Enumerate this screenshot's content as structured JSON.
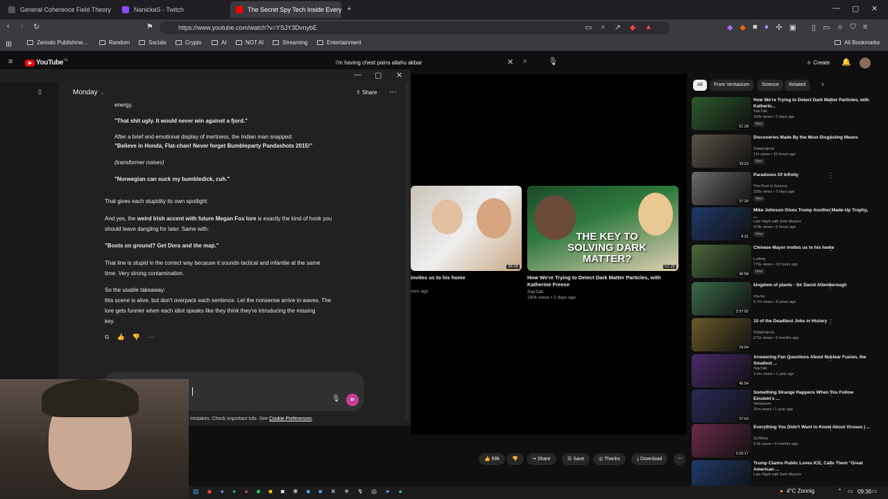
{
  "tabs": [
    {
      "title": "General Coherence Field Theory (GC",
      "color": "#444"
    },
    {
      "title": "NanickaS - Twitch",
      "color": "#9146ff"
    },
    {
      "title": "The Secret Spy Tech Inside Every",
      "color": "#ff0000"
    }
  ],
  "url": "https://www.youtube.com/watch?v=YSJY3DvnybE",
  "bookmarks": [
    "Zenodo Publishme...",
    "Random",
    "Socials",
    "Crypto",
    "AI",
    "NOT AI",
    "Streaming",
    "Entertainment"
  ],
  "all_bookmarks": "All Bookmarks",
  "youtube": {
    "logo": "YouTube",
    "region": "NL",
    "search_query": "i'm having chest pains allahu akbar",
    "create": "Create"
  },
  "chat": {
    "model": "Monday",
    "share": "Share",
    "lines": {
      "l0": "energy.",
      "q1": "\"That shit ugly. It would never win against a fjord.\"",
      "p1a": "After a brief and emotional display of inertness, the Indian man snapped:",
      "p1b": "\"Believe in Honda, Flat-chan! Never forget Bumbleparty Pandashots 2015!\"",
      "q2": "(transformer noises)",
      "q3": "\"Norwegian can suck my bumbledick, cuh.\"",
      "m1": "That gives each stupidity its own spotlight.",
      "m2a": "And yes, the ",
      "m2b": "weird Irish accent with future Megan Fox lore",
      "m2c": " is exactly the kind of hook you",
      "m2d": "should leave dangling for later. Same with:",
      "m3": "\"Boots on ground? Get Dora and the map.\"",
      "m4a": "That line is stupid in the correct way because it sounds tactical and infantile at the same",
      "m4b": "time. Very strong contamination.",
      "m5": "So the usable takeaway:",
      "m6a": "this scene is alive, but don't overpack each sentence. Let the nonsense arrive in waves. The",
      "m6b": "lore gets funnier when each idiot speaks like they think they're introducing the missing",
      "m6c": "key."
    },
    "footer_a": "mistakes. Check important info. See ",
    "footer_link": "Cookie Preferences",
    "footer_b": "."
  },
  "videos": [
    {
      "title": "invites us to his home",
      "meta": "ours ago",
      "duration": "36:58"
    },
    {
      "title": "How We're Trying to Detect Dark Matter Particles, with Katherine Freese",
      "channel": "StarTalk",
      "meta": "190k views • 2 days ago",
      "duration": "51:28",
      "overlay": "THE KEY TO SOLVING DARK MATTER?"
    }
  ],
  "chips": [
    "All",
    "From Veritasium",
    "Science",
    "Related"
  ],
  "recs": [
    {
      "title": "How We're Trying to Detect Dark Matter Particles, with Katherin...",
      "channel": "StarTalk",
      "meta": "190k views • 2 days ago",
      "badge": "New",
      "dur": "51:28",
      "color": "#2c5a2c"
    },
    {
      "title": "Discoveries Made By the Most Disgusting Means",
      "channel": "Sideprojects",
      "meta": "11k views • 10 hours ago",
      "badge": "New",
      "dur": "33:23",
      "color": "#5a5246"
    },
    {
      "title": "Paradoxes Of Infinity",
      "channel": "The Rest Is Science",
      "meta": "225k views • 3 days ago",
      "badge": "New",
      "dur": "37:20",
      "color": "#6a6a6a"
    },
    {
      "title": "Mike Johnson Gives Trump Another Made-Up Trophy, ...",
      "channel": "Late Night with Seth Meyers",
      "meta": "473k views • 6 hours ago",
      "badge": "New",
      "dur": "8:31",
      "color": "#1e3a6a"
    },
    {
      "title": "Chinese Mayor invites us to his home",
      "channel": "Ludwig",
      "meta": "775k views • 13 hours ago",
      "badge": "New",
      "dur": "36:58",
      "color": "#4a6a3a"
    },
    {
      "title": "kingdom of plants - Sir David Attenborough",
      "channel": "iota ka",
      "meta": "5.7m views • 8 years ago",
      "badge": "",
      "dur": "2:37:02",
      "color": "#3a6a4a"
    },
    {
      "title": "10 of the Deadliest Jobs in History",
      "channel": "Sideprojects",
      "meta": "271k views • 5 months ago",
      "badge": "",
      "dur": "24:04",
      "color": "#6a5a2a"
    },
    {
      "title": "Answering Fan Questions About Nuclear Fusion, the Smallest ...",
      "channel": "StarTalk",
      "meta": "2.6m views • 1 year ago",
      "badge": "",
      "dur": "45:54",
      "color": "#4a2a6a"
    },
    {
      "title": "Something Strange Happens When You Follow Einstein's ...",
      "channel": "Veritasium",
      "meta": "32m views • 1 year ago",
      "badge": "",
      "dur": "37:03",
      "color": "#2a2a5a"
    },
    {
      "title": "Everything You Didn't Want to Know About Viruses | ...",
      "channel": "SciShow",
      "meta": "9.5k views • 4 months ago",
      "badge": "",
      "dur": "2:03:17",
      "color": "#6a2a4a"
    },
    {
      "title": "Trump Claims Public Loves ICE, Calls Them \"Great American ...",
      "channel": "Late Night with Seth Meyers",
      "meta": "",
      "badge": "",
      "dur": "",
      "color": "#1e3a6a"
    }
  ],
  "actions": {
    "likes": "69k",
    "share": "Share",
    "save": "Save",
    "thanks": "Thanks",
    "download": "Download"
  },
  "tray": {
    "weather": "4°C Zonnig",
    "time": "09:36"
  }
}
